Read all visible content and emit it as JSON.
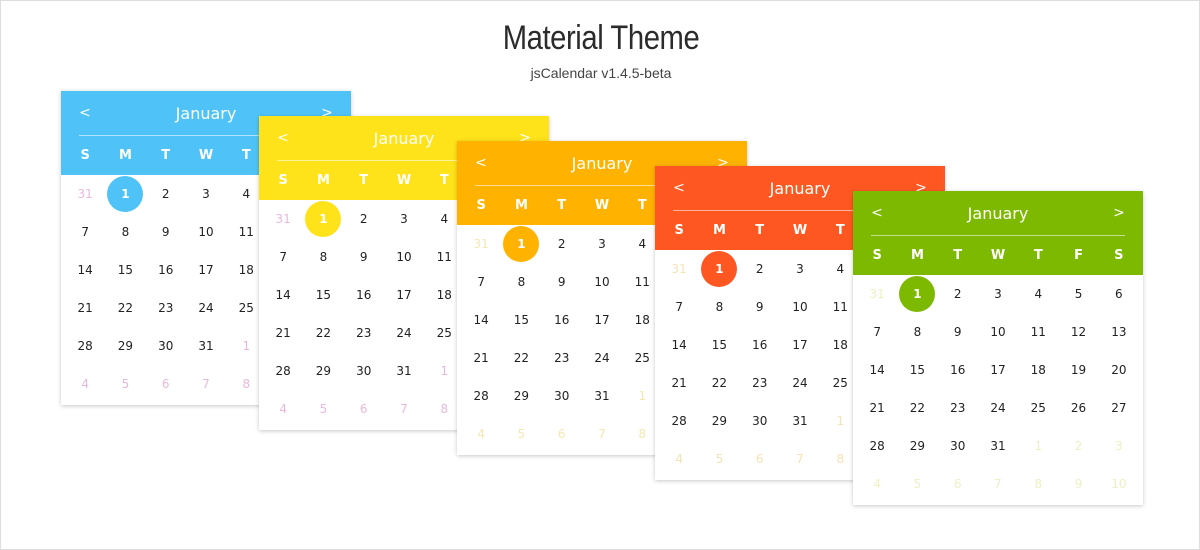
{
  "page": {
    "title": "Material Theme",
    "subtitle": "jsCalendar v1.4.5-beta"
  },
  "icons": {
    "prev": "chevron-left-icon",
    "next": "chevron-right-icon"
  },
  "calendars": [
    {
      "theme": "blue",
      "color": "#4fc3f7",
      "mutedColor": "#e9b8dd",
      "month": "January",
      "prev": "<",
      "next": ">"
    },
    {
      "theme": "yellow",
      "color": "#ffe31a",
      "mutedColor": "#e9b8dd",
      "month": "January",
      "prev": "<",
      "next": ">"
    },
    {
      "theme": "amber",
      "color": "#ffb300",
      "mutedColor": "#f3e9b0",
      "month": "January",
      "prev": "<",
      "next": ">"
    },
    {
      "theme": "orange",
      "color": "#ff5722",
      "mutedColor": "#f4e3b6",
      "month": "January",
      "prev": "<",
      "next": ">"
    },
    {
      "theme": "green",
      "color": "#7cb900",
      "mutedColor": "#eef0c4",
      "month": "January",
      "prev": "<",
      "next": ">"
    }
  ],
  "weekdays": [
    "S",
    "M",
    "T",
    "W",
    "T",
    "F",
    "S"
  ],
  "days": [
    {
      "t": "31",
      "m": true
    },
    {
      "t": "1",
      "sel": true
    },
    {
      "t": "2"
    },
    {
      "t": "3"
    },
    {
      "t": "4"
    },
    {
      "t": "5"
    },
    {
      "t": "6"
    },
    {
      "t": "7"
    },
    {
      "t": "8"
    },
    {
      "t": "9"
    },
    {
      "t": "10"
    },
    {
      "t": "11"
    },
    {
      "t": "12"
    },
    {
      "t": "13"
    },
    {
      "t": "14"
    },
    {
      "t": "15"
    },
    {
      "t": "16"
    },
    {
      "t": "17"
    },
    {
      "t": "18"
    },
    {
      "t": "19"
    },
    {
      "t": "20"
    },
    {
      "t": "21"
    },
    {
      "t": "22"
    },
    {
      "t": "23"
    },
    {
      "t": "24"
    },
    {
      "t": "25"
    },
    {
      "t": "26"
    },
    {
      "t": "27"
    },
    {
      "t": "28"
    },
    {
      "t": "29"
    },
    {
      "t": "30"
    },
    {
      "t": "31"
    },
    {
      "t": "1",
      "m": true
    },
    {
      "t": "2",
      "m": true
    },
    {
      "t": "3",
      "m": true
    },
    {
      "t": "4",
      "m": true
    },
    {
      "t": "5",
      "m": true
    },
    {
      "t": "6",
      "m": true
    },
    {
      "t": "7",
      "m": true
    },
    {
      "t": "8",
      "m": true
    },
    {
      "t": "9",
      "m": true
    },
    {
      "t": "10",
      "m": true
    }
  ]
}
